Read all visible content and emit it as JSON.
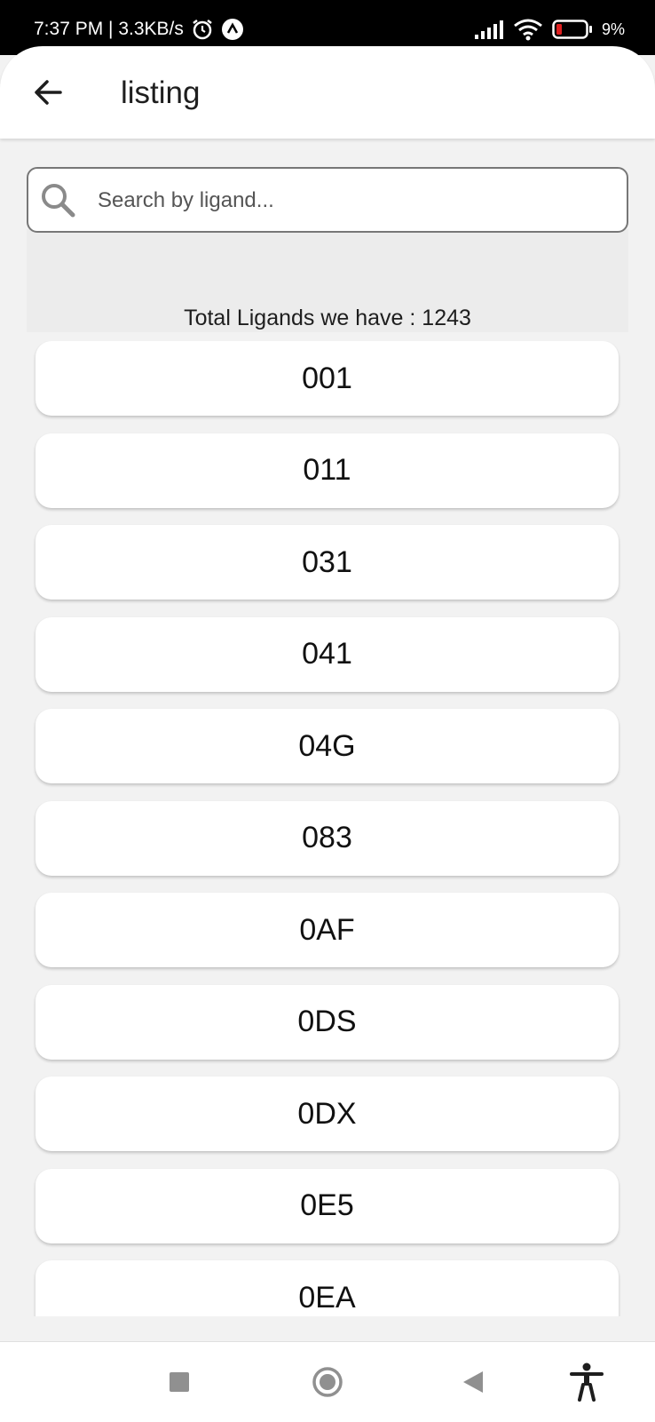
{
  "status_bar": {
    "time_speed": "7:37 PM | 3.3KB/s",
    "battery": "9%"
  },
  "app_bar": {
    "title": "listing"
  },
  "search": {
    "placeholder": "Search by ligand...",
    "value": ""
  },
  "total_label": "Total Ligands we have : 1243",
  "ligands": [
    "001",
    "011",
    "031",
    "041",
    "04G",
    "083",
    "0AF",
    "0DS",
    "0DX",
    "0E5",
    "0EA"
  ]
}
